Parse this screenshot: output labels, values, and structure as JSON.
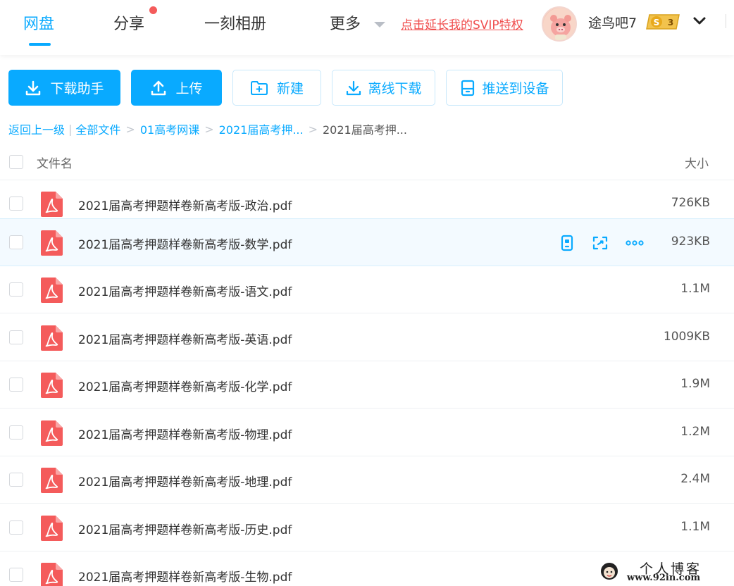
{
  "nav": {
    "tabs": [
      {
        "label": "网盘",
        "active": true
      },
      {
        "label": "分享",
        "has_dot": true
      },
      {
        "label": "一刻相册"
      },
      {
        "label": "更多",
        "has_caret": true
      }
    ],
    "svip_link": "点击延长我的SVIP特权",
    "username": "途鸟吧7",
    "vip_level": "3",
    "vip_symbol": "S"
  },
  "toolbar": {
    "download_helper": "下载助手",
    "upload": "上传",
    "new": "新建",
    "offline_download": "离线下载",
    "push_to_device": "推送到设备"
  },
  "breadcrumb": {
    "back": "返回上一级",
    "separator": "|",
    "items": [
      "全部文件",
      "01高考网课",
      "2021届高考押...",
      "2021届高考押..."
    ],
    "chevron": ">"
  },
  "list_header": {
    "name": "文件名",
    "size": "大小"
  },
  "files": [
    {
      "name": "2021届高考押题样卷新高考版-政治.pdf",
      "size": "726KB"
    },
    {
      "name": "2021届高考押题样卷新高考版-数学.pdf",
      "size": "923KB",
      "hovered": true
    },
    {
      "name": "2021届高考押题样卷新高考版-语文.pdf",
      "size": "1.1M"
    },
    {
      "name": "2021届高考押题样卷新高考版-英语.pdf",
      "size": "1009KB"
    },
    {
      "name": "2021届高考押题样卷新高考版-化学.pdf",
      "size": "1.9M"
    },
    {
      "name": "2021届高考押题样卷新高考版-物理.pdf",
      "size": "1.2M"
    },
    {
      "name": "2021届高考押题样卷新高考版-地理.pdf",
      "size": "2.4M"
    },
    {
      "name": "2021届高考押题样卷新高考版-历史.pdf",
      "size": "1.1M"
    },
    {
      "name": "2021届高考押题样卷新高考版-生物.pdf",
      "size": ""
    }
  ],
  "row_actions": [
    "phone-icon",
    "share-link-icon",
    "more-icon"
  ],
  "watermark": {
    "title": "个人博客",
    "url": "www.92in.com"
  },
  "colors": {
    "accent": "#09aaff",
    "alert": "#f04d4d",
    "pdf": "#f45b5b"
  }
}
